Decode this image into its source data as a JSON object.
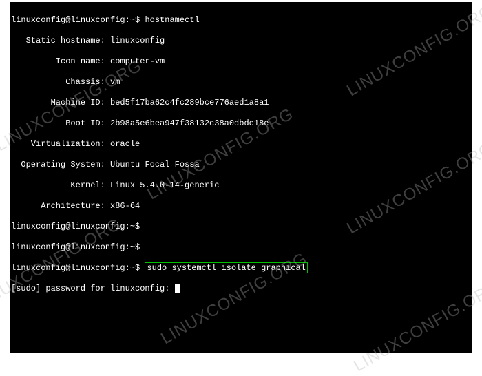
{
  "terminal": {
    "prompt": "linuxconfig@linuxconfig:~$",
    "cmd_hostnamectl": "hostnamectl",
    "output": {
      "static_hostname_label": "   Static hostname:",
      "static_hostname_value": "linuxconfig",
      "icon_name_label": "         Icon name:",
      "icon_name_value": "computer-vm",
      "chassis_label": "           Chassis:",
      "chassis_value": "vm",
      "machine_id_label": "        Machine ID:",
      "machine_id_value": "bed5f17ba62c4fc289bce776aed1a8a1",
      "boot_id_label": "           Boot ID:",
      "boot_id_value": "2b98a5e6bea947f38132c38a0dbdc18e",
      "virtualization_label": "    Virtualization:",
      "virtualization_value": "oracle",
      "os_label": "  Operating System:",
      "os_value": "Ubuntu Focal Fossa",
      "kernel_label": "            Kernel:",
      "kernel_value": "Linux 5.4.0-14-generic",
      "arch_label": "      Architecture:",
      "arch_value": "x86-64"
    },
    "cmd_highlighted": "sudo systemctl isolate graphical",
    "sudo_prompt": "[sudo] password for linuxconfig:",
    "cursor": " "
  },
  "watermark": "LINUXCONFIG.ORG"
}
